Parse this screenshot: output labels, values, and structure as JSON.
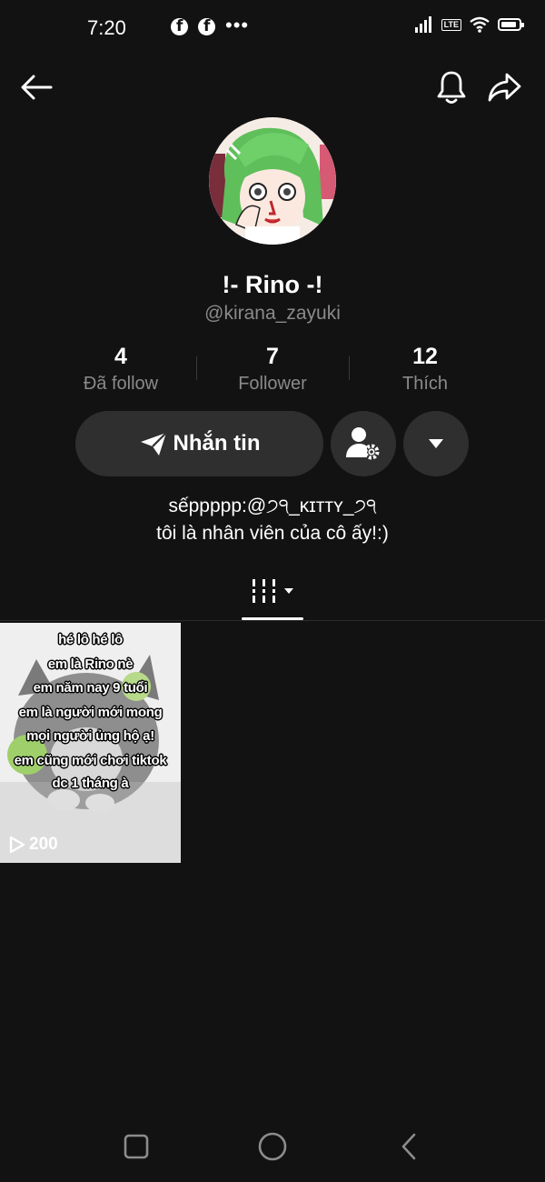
{
  "status_bar": {
    "time": "7:20",
    "notification_icons": [
      "facebook-icon",
      "facebook-icon",
      "more-dots-icon"
    ],
    "more_dots": "•••",
    "network_label": "LTE",
    "system_icons": [
      "signal-icon",
      "volte-icon",
      "wifi-icon",
      "battery-icon"
    ]
  },
  "top_bar": {
    "back_icon": "arrow-left-icon",
    "bell_icon": "bell-icon",
    "share_icon": "share-arrow-icon"
  },
  "profile": {
    "display_name": "!- Rino -!",
    "username": "@kirana_zayuki",
    "stats": [
      {
        "value": "4",
        "label": "Đã follow"
      },
      {
        "value": "7",
        "label": "Follower"
      },
      {
        "value": "12",
        "label": "Thích"
      }
    ],
    "message_button": "Nhắn tin",
    "message_icon": "send-icon",
    "manage_icon": "user-settings-icon",
    "dropdown_icon": "caret-down-icon",
    "bio": [
      "sếppppp:@੭੧_ᴋɪᴛᴛʏ_੭੧",
      "tôi là nhân viên của cô ấy!:)"
    ]
  },
  "tabs": {
    "active_icon": "videos-grid-icon"
  },
  "videos": [
    {
      "caption_lines": [
        "hé lô hé lô",
        "em là Rino nè",
        "em năm nay 9 tuổi",
        "em là người mới mong",
        "mọi người ủng hộ ạ!",
        "em cũng mới chơi tiktok",
        "dc 1 tháng à"
      ],
      "play_count": "200",
      "play_icon": "play-outline-icon"
    }
  ],
  "nav_bar": {
    "icons": [
      "recent-apps-icon",
      "home-icon",
      "back-icon"
    ]
  },
  "colors": {
    "background": "#121212",
    "surface": "#2f2f2f",
    "muted_text": "#8a8a8a"
  }
}
